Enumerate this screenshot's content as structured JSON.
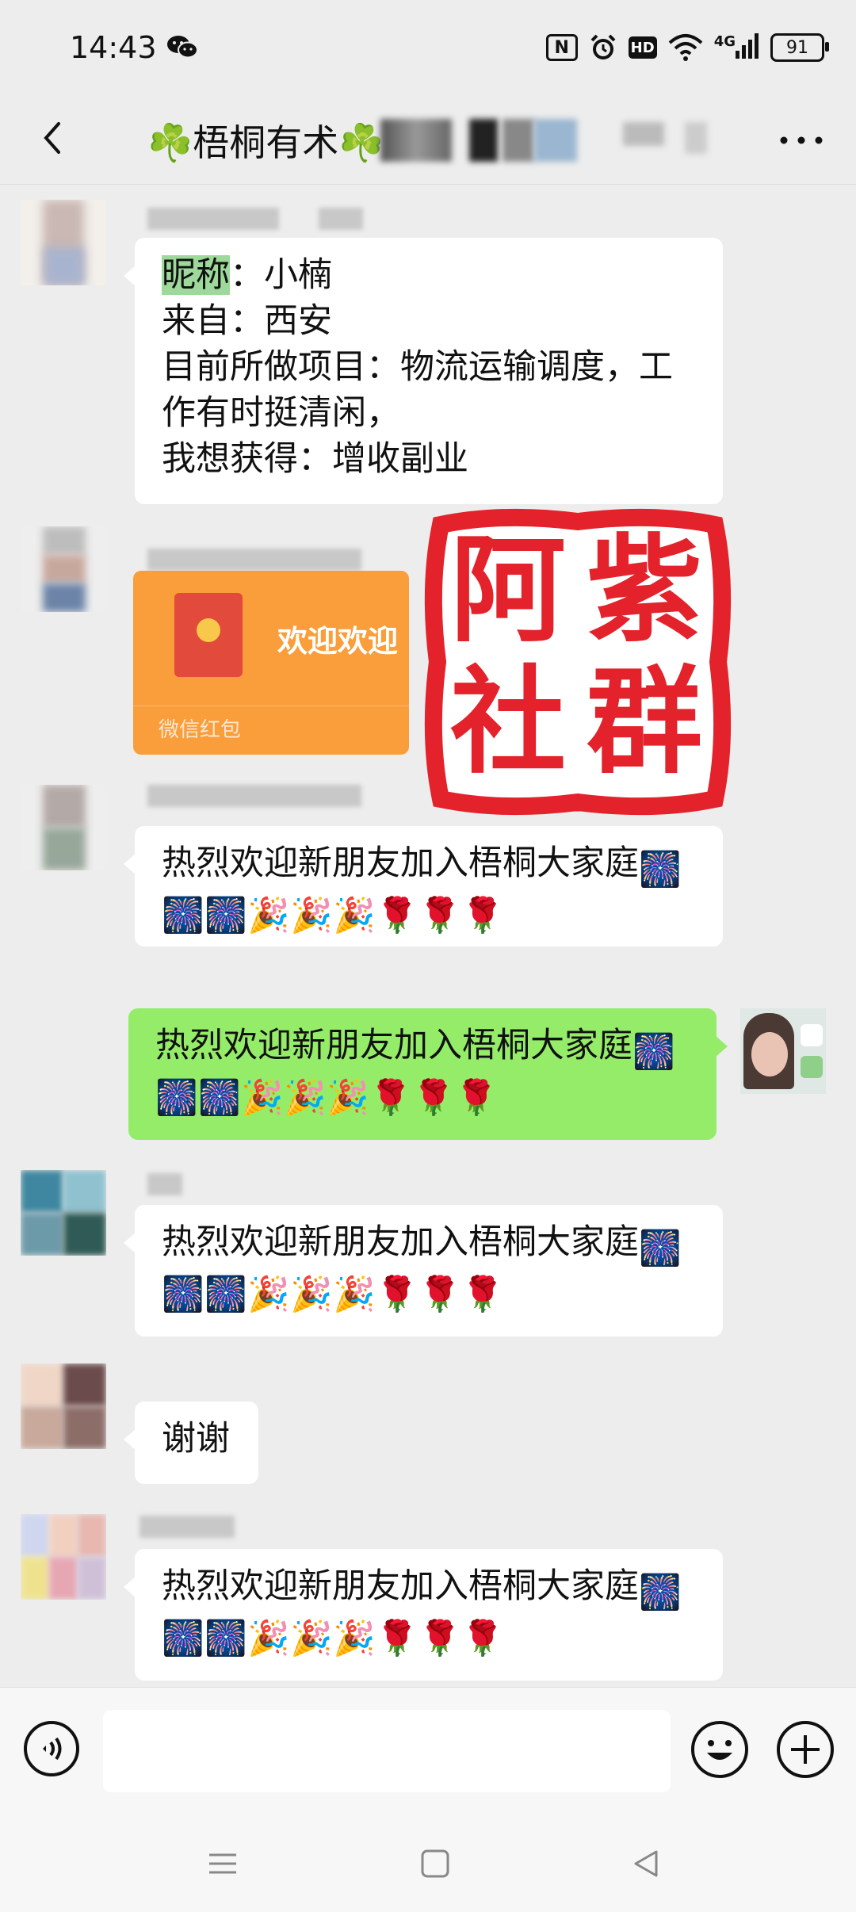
{
  "status_bar": {
    "time": "14:43",
    "battery": "91",
    "network": "4G",
    "hd": "HD",
    "nfc": "N",
    "icons": [
      "wechat-icon",
      "nfc-icon",
      "alarm-icon",
      "hd-icon",
      "wifi-icon",
      "signal-icon",
      "battery-icon"
    ]
  },
  "header": {
    "title": "☘️梧桐有术☘️",
    "icons": [
      "back-icon",
      "more-icon"
    ]
  },
  "messages": [
    {
      "side": "left",
      "type": "text",
      "lines": [
        "昵称：小楠",
        "来自：西安",
        "目前所做项目：物流运输调度，工",
        "作有时挺清闲，",
        "我想获得：增收副业"
      ],
      "highlight": "昵称"
    },
    {
      "side": "left",
      "type": "red_packet",
      "text": "欢迎欢迎",
      "label": "微信红包"
    },
    {
      "side": "left",
      "type": "text",
      "lines": [
        "热烈欢迎新朋友加入梧桐大家庭"
      ],
      "emoji": [
        "fireworks",
        "fireworks",
        "fireworks",
        "party-popper",
        "party-popper",
        "party-popper",
        "rose",
        "rose",
        "rose"
      ]
    },
    {
      "side": "right",
      "type": "text",
      "lines": [
        "热烈欢迎新朋友加入梧桐大家庭"
      ],
      "emoji": [
        "fireworks",
        "fireworks",
        "fireworks",
        "party-popper",
        "party-popper",
        "party-popper",
        "rose",
        "rose",
        "rose"
      ]
    },
    {
      "side": "left",
      "type": "text",
      "lines": [
        "热烈欢迎新朋友加入梧桐大家庭"
      ],
      "emoji": [
        "fireworks",
        "fireworks",
        "fireworks",
        "party-popper",
        "party-popper",
        "party-popper",
        "rose",
        "rose",
        "rose"
      ]
    },
    {
      "side": "left",
      "type": "text",
      "lines": [
        "谢谢"
      ]
    },
    {
      "side": "left",
      "type": "text",
      "lines": [
        "热烈欢迎新朋友加入梧桐大家庭"
      ],
      "emoji": [
        "fireworks",
        "fireworks",
        "fireworks",
        "party-popper",
        "party-popper",
        "party-popper",
        "rose",
        "rose",
        "rose"
      ]
    }
  ],
  "watermark_stamp": {
    "chars": [
      "阿",
      "紫",
      "社",
      "群"
    ],
    "color": "#e3222b"
  },
  "colors": {
    "background": "#ededed",
    "self_bubble": "#95ec69",
    "other_bubble": "#ffffff",
    "red_packet": "#f99e3b"
  },
  "input_bar": {
    "placeholder": "",
    "icons": [
      "voice-icon",
      "emoji-icon",
      "plus-icon"
    ]
  },
  "system_nav": {
    "icons": [
      "menu-icon",
      "home-icon",
      "back-triangle-icon"
    ]
  }
}
